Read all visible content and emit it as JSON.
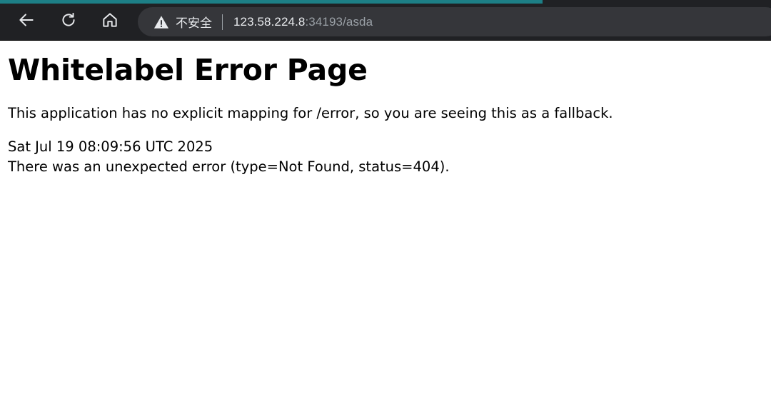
{
  "browser": {
    "security_label": "不安全",
    "url_host": "123.58.224.8",
    "url_rest": ":34193/asda",
    "accent_color": "#1d7f86",
    "icons": [
      "back-arrow-icon",
      "reload-icon",
      "home-icon",
      "warning-icon"
    ]
  },
  "page": {
    "title": "Whitelabel Error Page",
    "message": "This application has no explicit mapping for /error, so you are seeing this as a fallback.",
    "timestamp": "Sat Jul 19 08:09:56 UTC 2025",
    "error_detail": "There was an unexpected error (type=Not Found, status=404)."
  }
}
